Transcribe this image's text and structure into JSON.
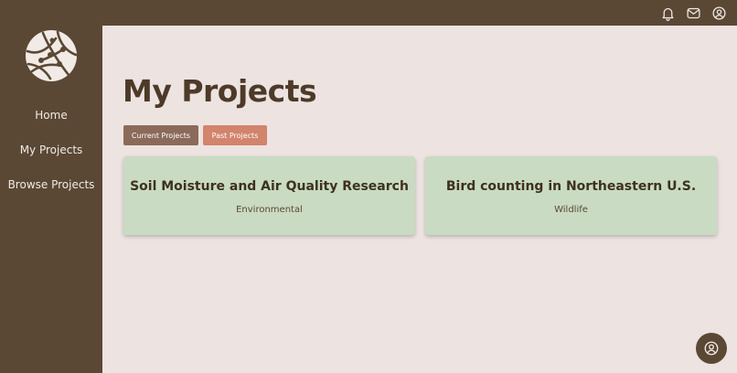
{
  "colors": {
    "header_bg": "#5a4834",
    "sidebar_bg": "#5a4834",
    "page_bg": "#ede3e1",
    "card_bg": "#c9dbc2",
    "tab_current_bg": "#8b6a5a",
    "tab_past_bg": "#d2846c",
    "title_color": "#4d3a28"
  },
  "topbar": {
    "icons": [
      "bell-icon",
      "mail-icon",
      "user-circle-icon"
    ]
  },
  "sidebar": {
    "logo_icon": "network-globe-icon",
    "items": [
      {
        "label": "Home"
      },
      {
        "label": "My Projects"
      },
      {
        "label": "Browse Projects"
      }
    ]
  },
  "main": {
    "title": "My Projects",
    "tabs": [
      {
        "label": "Current Projects"
      },
      {
        "label": "Past Projects"
      }
    ],
    "projects": [
      {
        "title": "Soil Moisture and Air Quality Research",
        "category": "Environmental"
      },
      {
        "title": "Bird counting in Northeastern U.S.",
        "category": "Wildlife"
      }
    ]
  },
  "fab": {
    "icon": "user-circle-icon"
  }
}
